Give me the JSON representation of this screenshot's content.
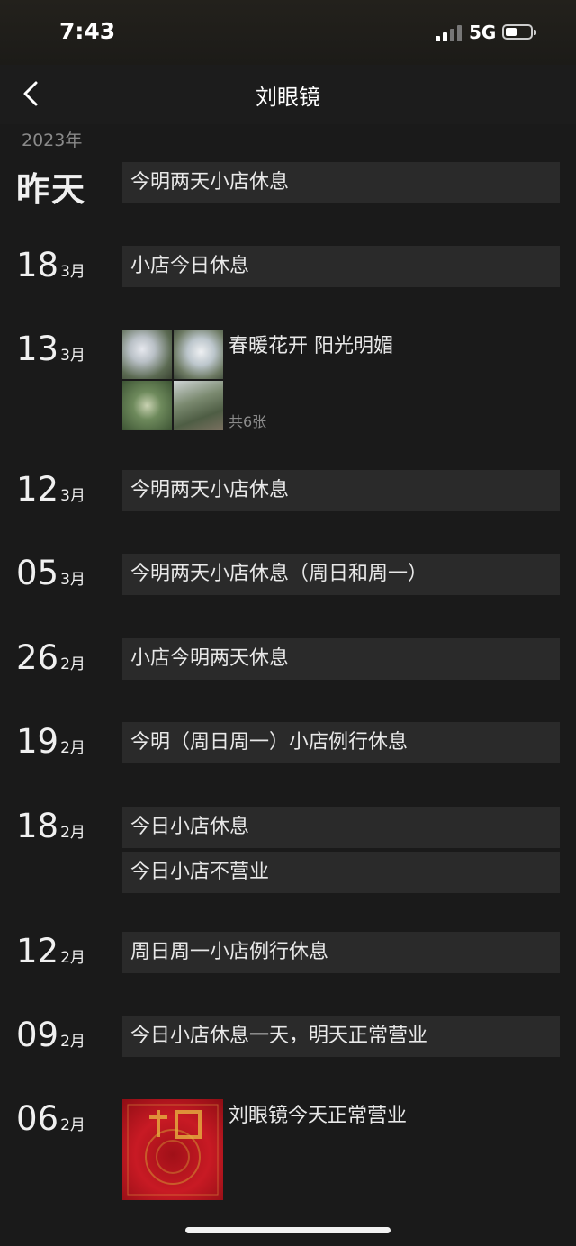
{
  "status": {
    "time": "7:43",
    "network": "5G"
  },
  "nav": {
    "title": "刘眼镜"
  },
  "year_label": "2023年",
  "entries": [
    {
      "big": "昨天",
      "text": "今明两天小店休息"
    },
    {
      "day": "18",
      "month": "3月",
      "text": "小店今日休息"
    },
    {
      "day": "13",
      "month": "3月",
      "caption": "春暖花开 阳光明媚",
      "count": "共6张"
    },
    {
      "day": "12",
      "month": "3月",
      "text": "今明两天小店休息"
    },
    {
      "day": "05",
      "month": "3月",
      "text": "今明两天小店休息（周日和周一）"
    },
    {
      "day": "26",
      "month": "2月",
      "text": "小店今明两天休息"
    },
    {
      "day": "19",
      "month": "2月",
      "text": "今明（周日周一）小店例行休息"
    },
    {
      "day": "18",
      "month": "2月",
      "text": "今日小店休息",
      "text2": "今日小店不营业"
    },
    {
      "day": "12",
      "month": "2月",
      "text": "周日周一小店例行休息"
    },
    {
      "day": "09",
      "month": "2月",
      "text": "今日小店休息一天，明天正常营业"
    },
    {
      "day": "06",
      "month": "2月",
      "caption": "刘眼镜今天正常营业"
    }
  ],
  "colors": {
    "background": "#1a1a1a",
    "card": "#2a2a2a",
    "text": "#e8e8e8",
    "muted": "#8a8a8a"
  }
}
